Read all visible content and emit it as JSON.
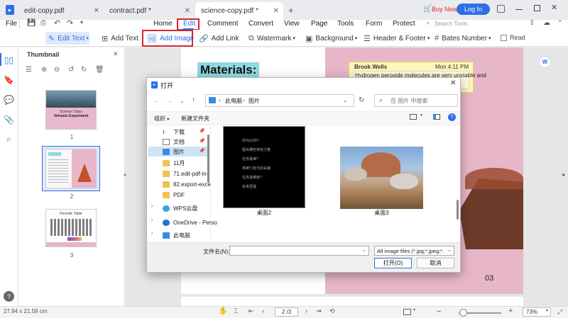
{
  "tabs": [
    {
      "label": "edit-copy.pdf",
      "active": false
    },
    {
      "label": "contract.pdf *",
      "active": false
    },
    {
      "label": "science-copy.pdf *",
      "active": true
    }
  ],
  "titlebar": {
    "new_tab": "+",
    "buy_now": "Buy Now",
    "login": "Log In"
  },
  "menu": {
    "file": "File",
    "items": [
      "Home",
      "Edit",
      "Comment",
      "Convert",
      "View",
      "Page",
      "Tools",
      "Form",
      "Protect"
    ],
    "search_placeholder": "Search Tools"
  },
  "toolbar": {
    "edit_text": "Edit Text",
    "add_text": "Add Text",
    "add_image": "Add Image",
    "add_link": "Add Link",
    "watermark": "Watermark",
    "background": "Background",
    "header_footer": "Header & Footer",
    "bates_number": "Bates Number",
    "read": "Read"
  },
  "thumbnail": {
    "title": "Thumbnail",
    "pages": [
      "1",
      "2",
      "3"
    ],
    "page1": {
      "line1": "Science Class",
      "line2": "Volcanic Experiment"
    },
    "page3": {
      "title": "Periodic Table"
    }
  },
  "document": {
    "materials": "Materials:",
    "note_author": "Brook Wells",
    "note_time": "Mon 4:11 PM",
    "note_text": "Hydrogen peroxide molecules are very unstable and",
    "page_num": "03"
  },
  "dialog": {
    "title": "打开",
    "breadcrumb": [
      "此电脑",
      "图片"
    ],
    "search_placeholder": "在 图片 中搜索",
    "organize": "组织",
    "new_folder": "新建文件夹",
    "tree": [
      "下载",
      "文档",
      "图片",
      "11月",
      "71.edit-pdf-in-",
      "82.export-exce",
      "PDF",
      "WPS云盘",
      "OneDrive - Perso",
      "此电脑"
    ],
    "files": [
      {
        "name": "桌面2",
        "lines": [
          "何为UI3D?",
          "图出哪些常有力量",
          "任务最难?",
          "棉被勺有为的采编",
          "任务最难度?",
          "有来思建"
        ]
      },
      {
        "name": "桌面3"
      }
    ],
    "filename_label": "文件名(N):",
    "filename_value": "",
    "filetype": "All image files (*.jpg;*.jpeg;*.",
    "open_button": "打开(O)",
    "cancel_button": "取消"
  },
  "status": {
    "page_size": "27.94 x 21.59 cm",
    "page_indicator": "2 /3",
    "zoom": "73%"
  },
  "colors": {
    "accent": "#2f6fe4",
    "highlight": "#d9272e",
    "note_bg": "#fdf6b7",
    "page_pink": "#e7b6c9",
    "materials_bg": "#8fd9e0"
  }
}
